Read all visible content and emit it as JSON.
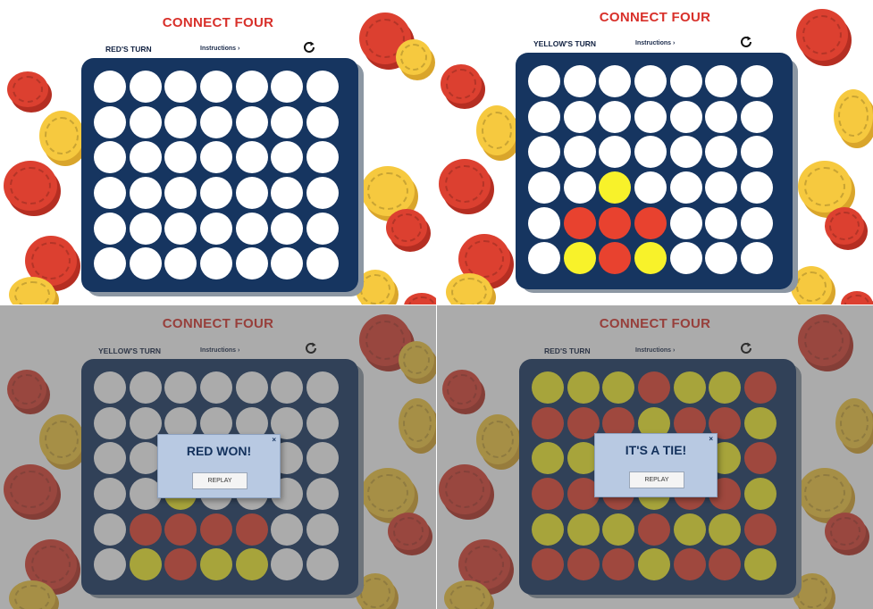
{
  "app": {
    "title": "CONNECT FOUR",
    "instructions_link": "Instructions ›",
    "restart_icon": "restart-icon",
    "colors": {
      "title": "#d8302a",
      "board": "#163560",
      "red_piece": "#e8422f",
      "yellow_piece": "#f8f22a",
      "empty": "#ffffff"
    }
  },
  "screens": [
    {
      "turn_label": "RED'S TURN",
      "board": [
        [
          "e",
          "e",
          "e",
          "e",
          "e",
          "e",
          "e"
        ],
        [
          "e",
          "e",
          "e",
          "e",
          "e",
          "e",
          "e"
        ],
        [
          "e",
          "e",
          "e",
          "e",
          "e",
          "e",
          "e"
        ],
        [
          "e",
          "e",
          "e",
          "e",
          "e",
          "e",
          "e"
        ],
        [
          "e",
          "e",
          "e",
          "e",
          "e",
          "e",
          "e"
        ],
        [
          "e",
          "e",
          "e",
          "e",
          "e",
          "e",
          "e"
        ]
      ]
    },
    {
      "turn_label": "YELLOW'S TURN",
      "board": [
        [
          "e",
          "e",
          "e",
          "e",
          "e",
          "e",
          "e"
        ],
        [
          "e",
          "e",
          "e",
          "e",
          "e",
          "e",
          "e"
        ],
        [
          "e",
          "e",
          "e",
          "e",
          "e",
          "e",
          "e"
        ],
        [
          "e",
          "e",
          "y",
          "e",
          "e",
          "e",
          "e"
        ],
        [
          "e",
          "r",
          "r",
          "r",
          "e",
          "e",
          "e"
        ],
        [
          "e",
          "y",
          "r",
          "y",
          "e",
          "e",
          "e"
        ]
      ]
    },
    {
      "turn_label": "YELLOW'S TURN",
      "board": [
        [
          "e",
          "e",
          "e",
          "e",
          "e",
          "e",
          "e"
        ],
        [
          "e",
          "e",
          "e",
          "e",
          "e",
          "e",
          "e"
        ],
        [
          "e",
          "e",
          "e",
          "e",
          "e",
          "e",
          "e"
        ],
        [
          "e",
          "e",
          "y",
          "e",
          "e",
          "e",
          "e"
        ],
        [
          "e",
          "r",
          "r",
          "r",
          "r",
          "e",
          "e"
        ],
        [
          "e",
          "y",
          "r",
          "y",
          "y",
          "e",
          "e"
        ]
      ],
      "dialog": {
        "message": "RED WON!",
        "button": "REPLAY",
        "close": "×"
      }
    },
    {
      "turn_label": "RED'S TURN",
      "board": [
        [
          "y",
          "y",
          "y",
          "r",
          "y",
          "y",
          "r"
        ],
        [
          "r",
          "r",
          "r",
          "y",
          "r",
          "r",
          "y"
        ],
        [
          "y",
          "y",
          "y",
          "r",
          "y",
          "y",
          "r"
        ],
        [
          "r",
          "r",
          "r",
          "y",
          "r",
          "r",
          "y"
        ],
        [
          "y",
          "y",
          "y",
          "r",
          "y",
          "y",
          "r"
        ],
        [
          "r",
          "r",
          "r",
          "y",
          "r",
          "r",
          "y"
        ]
      ],
      "dialog": {
        "message": "IT'S A TIE!",
        "button": "REPLAY",
        "close": "×"
      }
    }
  ]
}
